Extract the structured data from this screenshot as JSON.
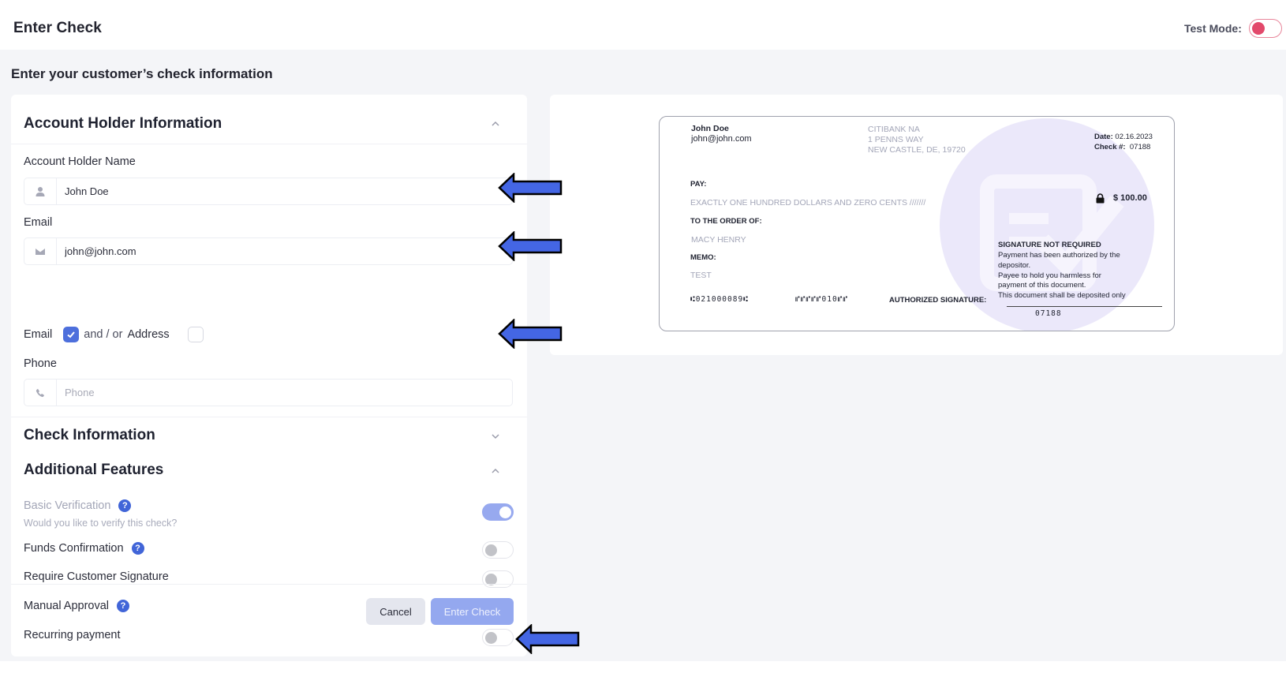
{
  "header": {
    "title": "Enter Check",
    "test_mode_label": "Test Mode:",
    "test_mode_on": false,
    "test_mode_color": "#e2496b"
  },
  "page": {
    "subtitle": "Enter your customer’s check information"
  },
  "account_holder": {
    "section_title": "Account Holder Information",
    "expanded": true,
    "name_label": "Account Holder Name",
    "name_value": "John Doe",
    "email_label": "Email",
    "email_value": "john@john.com",
    "delivery": {
      "email_label": "Email",
      "email_checked": true,
      "separator": "and / or",
      "address_label": "Address",
      "address_checked": false
    },
    "phone_label": "Phone",
    "phone_value": "",
    "phone_placeholder": "Phone"
  },
  "check_information": {
    "section_title": "Check Information",
    "expanded": false
  },
  "additional_features": {
    "section_title": "Additional Features",
    "expanded": true,
    "items": [
      {
        "label": "Basic Verification",
        "sublabel": "Would you like to verify this check?",
        "help": true,
        "enabled": true,
        "disabled": true
      },
      {
        "label": "Funds Confirmation",
        "help": true,
        "enabled": false
      },
      {
        "label": "Require Customer Signature",
        "help": false,
        "enabled": false
      },
      {
        "label": "Manual Approval",
        "help": true,
        "enabled": false
      },
      {
        "label": "Recurring payment",
        "help": false,
        "enabled": false
      }
    ],
    "help_icon_glyph": "?"
  },
  "actions": {
    "cancel_label": "Cancel",
    "enter_label": "Enter Check",
    "accent": "#94a8ef"
  },
  "check_preview": {
    "payer_name": "John Doe",
    "payer_email": "john@john.com",
    "bank_name": "CITIBANK NA",
    "bank_address_1": "1 PENNS WAY",
    "bank_address_2": "NEW CASTLE, DE, 19720",
    "date_label": "Date:",
    "date_value": "02.16.2023",
    "check_no_label": "Check #:",
    "check_no_value": "07188",
    "pay_label": "PAY:",
    "amount_words": "EXACTLY ONE HUNDRED DOLLARS AND ZERO CENTS ///////",
    "amount": "$ 100.00",
    "order_label": "TO THE ORDER OF:",
    "payee": "MACY HENRY",
    "memo_label": "MEMO:",
    "memo": "TEST",
    "routing_micr": "⑆021000089⑆",
    "account_micr": "⑈⑈⑈⑈⑈010⑈⑈",
    "auth_sig_label": "AUTHORIZED SIGNATURE:",
    "sig_note_title": "SIGNATURE NOT REQUIRED",
    "sig_note_1": "Payment has been authorized by the",
    "sig_note_2": "depositor.",
    "sig_note_3": "Payee to hold you harmless for",
    "sig_note_4": "payment of this document.",
    "sig_note_5": "This document shall be deposited only",
    "check_micr": "07188"
  },
  "annotations": {
    "arrow_color": "#4466e4"
  }
}
